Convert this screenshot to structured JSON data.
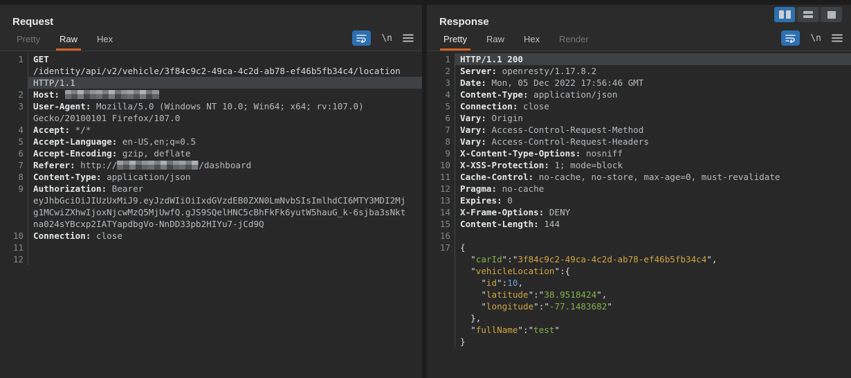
{
  "colors": {
    "accent_orange": "#d4622a",
    "accent_blue": "#2e6fae",
    "wrap_button_blue": "#2d6fb3",
    "editor_background": "#282828",
    "line_highlight": "#3e4245",
    "json_key_green": "#82b049",
    "json_key_yellow": "#cfa443",
    "json_number_blue": "#67a0d6"
  },
  "layout_buttons": [
    {
      "name": "layout-side-by-side-button",
      "glyph": "columns",
      "active": true
    },
    {
      "name": "layout-stacked-button",
      "glyph": "rows",
      "active": false
    },
    {
      "name": "layout-single-button",
      "glyph": "single",
      "active": false
    }
  ],
  "editor_toolbar": {
    "newline_label": "\\n"
  },
  "request": {
    "title": "Request",
    "tabs": [
      {
        "label": "Pretty",
        "state": "dim"
      },
      {
        "label": "Raw",
        "state": "active"
      },
      {
        "label": "Hex",
        "state": "normal"
      }
    ],
    "rows": [
      {
        "num": "1",
        "seg": [
          {
            "t": "GET",
            "c": "bold"
          }
        ]
      },
      {
        "seg": [
          {
            "t": "/identity/api/v2/vehicle/3f84c9c2-49ca-4c2d-ab78-ef46b5fb34c4/location",
            "c": "plain"
          }
        ]
      },
      {
        "hl": true,
        "seg": [
          {
            "t": "HTTP/1.1",
            "c": "plain"
          }
        ]
      },
      {
        "num": "2",
        "seg": [
          {
            "t": "Host: ",
            "c": "name"
          },
          {
            "redact": 136
          }
        ]
      },
      {
        "num": "3",
        "seg": [
          {
            "t": "User-Agent: ",
            "c": "name"
          },
          {
            "t": "Mozilla/5.0 (Windows NT 10.0; Win64; x64; rv:107.0)",
            "c": "val"
          }
        ]
      },
      {
        "seg": [
          {
            "t": "Gecko/20100101 Firefox/107.0",
            "c": "val"
          }
        ]
      },
      {
        "num": "4",
        "seg": [
          {
            "t": "Accept: ",
            "c": "name"
          },
          {
            "t": "*/*",
            "c": "val"
          }
        ]
      },
      {
        "num": "5",
        "seg": [
          {
            "t": "Accept-Language: ",
            "c": "name"
          },
          {
            "t": "en-US,en;q=0.5",
            "c": "val"
          }
        ]
      },
      {
        "num": "6",
        "seg": [
          {
            "t": "Accept-Encoding: ",
            "c": "name"
          },
          {
            "t": "gzip, deflate",
            "c": "val"
          }
        ]
      },
      {
        "num": "7",
        "seg": [
          {
            "t": "Referer: ",
            "c": "name"
          },
          {
            "t": "http://",
            "c": "val"
          },
          {
            "redact": 118
          },
          {
            "t": "/dashboard",
            "c": "val"
          }
        ]
      },
      {
        "num": "8",
        "seg": [
          {
            "t": "Content-Type: ",
            "c": "name"
          },
          {
            "t": "application/json",
            "c": "val"
          }
        ]
      },
      {
        "num": "9",
        "seg": [
          {
            "t": "Authorization: ",
            "c": "name"
          },
          {
            "t": "Bearer",
            "c": "val"
          }
        ]
      },
      {
        "seg": [
          {
            "t": "eyJhbGciOiJIUzUxMiJ9.eyJzdWIiOiIxdGVzdEB0ZXN0LmNvbSIsImlhdCI6MTY3MDI2Mj",
            "c": "val"
          }
        ]
      },
      {
        "seg": [
          {
            "t": "g1MCwiZXhwIjoxNjcwMzQ5MjUwfQ.gJS9SQelHNC5cBhFkFk6yutW5hauG_k-6sjba3sNkt",
            "c": "val"
          }
        ]
      },
      {
        "seg": [
          {
            "t": "na024sYBcxp2IATYapdbgVo-NnDD33pb2HIYu7-jCd9Q",
            "c": "val"
          }
        ]
      },
      {
        "num": "10",
        "seg": [
          {
            "t": "Connection: ",
            "c": "name"
          },
          {
            "t": "close",
            "c": "val"
          }
        ]
      },
      {
        "num": "11",
        "seg": []
      },
      {
        "num": "12",
        "seg": []
      }
    ]
  },
  "response": {
    "title": "Response",
    "tabs": [
      {
        "label": "Pretty",
        "state": "active"
      },
      {
        "label": "Raw",
        "state": "normal"
      },
      {
        "label": "Hex",
        "state": "normal"
      },
      {
        "label": "Render",
        "state": "dim"
      }
    ],
    "rows": [
      {
        "num": "1",
        "hl": true,
        "seg": [
          {
            "t": "HTTP/1.1 200",
            "c": "bold"
          }
        ]
      },
      {
        "num": "2",
        "seg": [
          {
            "t": "Server: ",
            "c": "name"
          },
          {
            "t": "openresty/1.17.8.2",
            "c": "val"
          }
        ]
      },
      {
        "num": "3",
        "seg": [
          {
            "t": "Date: ",
            "c": "name"
          },
          {
            "t": "Mon, 05 Dec 2022 17:56:46 GMT",
            "c": "val"
          }
        ]
      },
      {
        "num": "4",
        "seg": [
          {
            "t": "Content-Type: ",
            "c": "name"
          },
          {
            "t": "application/json",
            "c": "val"
          }
        ]
      },
      {
        "num": "5",
        "seg": [
          {
            "t": "Connection: ",
            "c": "name"
          },
          {
            "t": "close",
            "c": "val"
          }
        ]
      },
      {
        "num": "6",
        "seg": [
          {
            "t": "Vary: ",
            "c": "name"
          },
          {
            "t": "Origin",
            "c": "val"
          }
        ]
      },
      {
        "num": "7",
        "seg": [
          {
            "t": "Vary: ",
            "c": "name"
          },
          {
            "t": "Access-Control-Request-Method",
            "c": "val"
          }
        ]
      },
      {
        "num": "8",
        "seg": [
          {
            "t": "Vary: ",
            "c": "name"
          },
          {
            "t": "Access-Control-Request-Headers",
            "c": "val"
          }
        ]
      },
      {
        "num": "9",
        "seg": [
          {
            "t": "X-Content-Type-Options: ",
            "c": "name"
          },
          {
            "t": "nosniff",
            "c": "val"
          }
        ]
      },
      {
        "num": "10",
        "seg": [
          {
            "t": "X-XSS-Protection: ",
            "c": "name"
          },
          {
            "t": "1; mode=block",
            "c": "val"
          }
        ]
      },
      {
        "num": "11",
        "seg": [
          {
            "t": "Cache-Control: ",
            "c": "name"
          },
          {
            "t": "no-cache, no-store, max-age=0, must-revalidate",
            "c": "val"
          }
        ]
      },
      {
        "num": "12",
        "seg": [
          {
            "t": "Pragma: ",
            "c": "name"
          },
          {
            "t": "no-cache",
            "c": "val"
          }
        ]
      },
      {
        "num": "13",
        "seg": [
          {
            "t": "Expires: ",
            "c": "name"
          },
          {
            "t": "0",
            "c": "val"
          }
        ]
      },
      {
        "num": "14",
        "seg": [
          {
            "t": "X-Frame-Options: ",
            "c": "name"
          },
          {
            "t": "DENY",
            "c": "val"
          }
        ]
      },
      {
        "num": "15",
        "seg": [
          {
            "t": "Content-Length: ",
            "c": "name"
          },
          {
            "t": "144",
            "c": "val"
          }
        ]
      },
      {
        "num": "16",
        "seg": []
      },
      {
        "num": "17",
        "seg": [
          {
            "t": "{",
            "c": "punct"
          }
        ]
      },
      {
        "seg": [
          {
            "t": "  \"",
            "c": "punct"
          },
          {
            "t": "carId",
            "c": "key-g"
          },
          {
            "t": "\":\"",
            "c": "punct"
          },
          {
            "t": "3f84c9c2-49ca-4c2d-ab78-ef46b5fb34c4",
            "c": "str-y"
          },
          {
            "t": "\",",
            "c": "punct"
          }
        ]
      },
      {
        "seg": [
          {
            "t": "  \"",
            "c": "punct"
          },
          {
            "t": "vehicleLocation",
            "c": "key-y"
          },
          {
            "t": "\":{",
            "c": "punct"
          }
        ]
      },
      {
        "seg": [
          {
            "t": "    \"",
            "c": "punct"
          },
          {
            "t": "id",
            "c": "key-y"
          },
          {
            "t": "\":",
            "c": "punct"
          },
          {
            "t": "10",
            "c": "num"
          },
          {
            "t": ",",
            "c": "punct"
          }
        ]
      },
      {
        "seg": [
          {
            "t": "    \"",
            "c": "punct"
          },
          {
            "t": "latitude",
            "c": "key-y"
          },
          {
            "t": "\":\"",
            "c": "punct"
          },
          {
            "t": "38.9518424",
            "c": "str-g"
          },
          {
            "t": "\",",
            "c": "punct"
          }
        ]
      },
      {
        "seg": [
          {
            "t": "    \"",
            "c": "punct"
          },
          {
            "t": "longitude",
            "c": "key-y"
          },
          {
            "t": "\":\"",
            "c": "punct"
          },
          {
            "t": "-77.1483682",
            "c": "str-g"
          },
          {
            "t": "\"",
            "c": "punct"
          }
        ]
      },
      {
        "seg": [
          {
            "t": "  },",
            "c": "punct"
          }
        ]
      },
      {
        "seg": [
          {
            "t": "  \"",
            "c": "punct"
          },
          {
            "t": "fullName",
            "c": "key-y"
          },
          {
            "t": "\":\"",
            "c": "punct"
          },
          {
            "t": "test",
            "c": "str-g"
          },
          {
            "t": "\"",
            "c": "punct"
          }
        ]
      },
      {
        "seg": [
          {
            "t": "}",
            "c": "punct"
          }
        ]
      }
    ]
  }
}
